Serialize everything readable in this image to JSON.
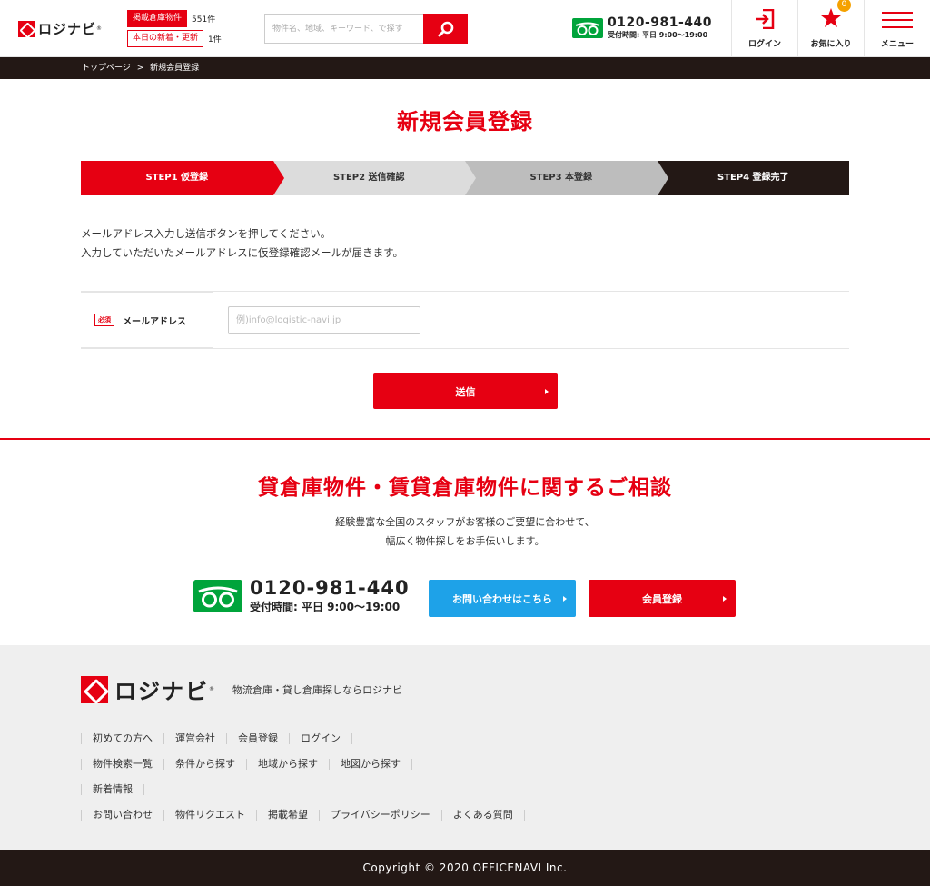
{
  "colors": {
    "brand": "#e60012",
    "dark": "#231815",
    "free_dial": "#00a43b",
    "blue": "#1ea2e8",
    "badge": "#f5a100"
  },
  "header": {
    "logo_text": "ロジナビ",
    "logo_reg": "®",
    "counts": [
      {
        "label": "掲載倉庫物件",
        "value": "551件"
      },
      {
        "label": "本日の新着・更新",
        "value": "1件"
      }
    ],
    "search_placeholder": "物件名、地域、キーワード、で探す",
    "phone": "0120-981-440",
    "hours": "受付時間: 平日 9:00〜19:00",
    "nav": [
      {
        "label": "ログイン",
        "icon": "login-icon"
      },
      {
        "label": "お気に入り",
        "icon": "star-icon",
        "badge": "0"
      },
      {
        "label": "メニュー",
        "icon": "hamburger-icon"
      }
    ]
  },
  "breadcrumb": {
    "home": "トップページ",
    "sep": ">",
    "current": "新規会員登録"
  },
  "main": {
    "title": "新規会員登録",
    "steps": [
      "STEP1 仮登録",
      "STEP2 送信確認",
      "STEP3 本登録",
      "STEP4 登録完了"
    ],
    "intro_line1": "メールアドレス入力し送信ボタンを押してください。",
    "intro_line2": "入力していただいたメールアドレスに仮登録確認メールが届きます。",
    "form": {
      "required_tag": "必須",
      "email_label": "メールアドレス",
      "email_placeholder": "例)info@logistic-navi.jp"
    },
    "submit_label": "送信"
  },
  "consult": {
    "title": "貸倉庫物件・賃貸倉庫物件に関するご相談",
    "text_line1": "経験豊富な全国のスタッフがお客様のご要望に合わせて、",
    "text_line2": "幅広く物件探しをお手伝いします。",
    "phone": "0120-981-440",
    "hours": "受付時間: 平日 9:00〜19:00",
    "contact_label": "お問い合わせはこちら",
    "member_label": "会員登録"
  },
  "footer": {
    "logo_text": "ロジナビ",
    "tagline": "物流倉庫・貸し倉庫探しならロジナビ",
    "link_rows": [
      [
        "初めての方へ",
        "運営会社",
        "会員登録",
        "ログイン"
      ],
      [
        "物件検索一覧",
        "条件から探す",
        "地域から探す",
        "地図から探す"
      ],
      [
        "新着情報"
      ],
      [
        "お問い合わせ",
        "物件リクエスト",
        "掲載希望",
        "プライバシーポリシー",
        "よくある質問"
      ]
    ],
    "copyright": "Copyright © 2020 OFFICENAVI Inc."
  }
}
